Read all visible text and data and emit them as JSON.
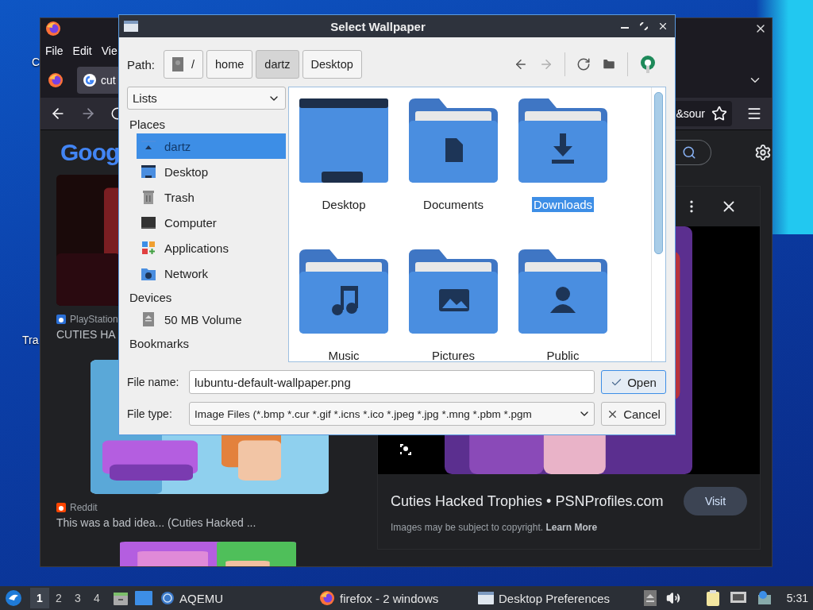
{
  "desktop_labels": [
    "C",
    "Tra"
  ],
  "firefox": {
    "menu": [
      "File",
      "Edit",
      "Vie"
    ],
    "tab": {
      "title": "cut"
    },
    "url_fragment": "&sour",
    "logo_text": "Goog",
    "results": [
      {
        "source": "PlayStation",
        "title": "CUTIES HA",
        "kind": "playstation"
      },
      {
        "source": "Reddit",
        "title": "This was a bad idea... (Cuties Hacked ...",
        "kind": "reddit"
      }
    ],
    "preview": {
      "title": "Cuties Hacked Trophies • PSNProfiles.com",
      "button": "Visit",
      "notice": "Images may be subject to copyright.",
      "link": "Learn More"
    }
  },
  "dialog": {
    "title": "Select Wallpaper",
    "path_label": "Path:",
    "path": [
      {
        "label": "/",
        "kind": "root",
        "selected": false
      },
      {
        "label": "home",
        "kind": "dir",
        "selected": false
      },
      {
        "label": "dartz",
        "kind": "dir",
        "selected": true
      },
      {
        "label": "Desktop",
        "kind": "dir",
        "selected": false
      }
    ],
    "toolbar": [
      {
        "kind": "back",
        "disabled": false
      },
      {
        "kind": "forward",
        "disabled": true
      },
      {
        "kind": "reload",
        "disabled": false
      },
      {
        "kind": "new-folder",
        "disabled": false
      },
      {
        "kind": "app",
        "disabled": false
      }
    ],
    "view_select": "Lists",
    "sidebar": [
      {
        "heading": "Places",
        "items": [
          {
            "label": "dartz",
            "kind": "home",
            "selected": true
          },
          {
            "label": "Desktop",
            "kind": "desktop",
            "selected": false
          },
          {
            "label": "Trash",
            "kind": "trash",
            "selected": false
          },
          {
            "label": "Computer",
            "kind": "computer",
            "selected": false
          },
          {
            "label": "Applications",
            "kind": "applications",
            "selected": false
          },
          {
            "label": "Network",
            "kind": "network",
            "selected": false
          }
        ]
      },
      {
        "heading": "Devices",
        "items": [
          {
            "label": "50 MB Volume",
            "kind": "drive",
            "selected": false
          }
        ]
      },
      {
        "heading": "Bookmarks"
      }
    ],
    "files": [
      {
        "name": "Desktop",
        "kind": "desktop",
        "selected": false
      },
      {
        "name": "Documents",
        "kind": "documents",
        "selected": false
      },
      {
        "name": "Downloads",
        "kind": "downloads",
        "selected": true
      },
      {
        "name": "Music",
        "kind": "music",
        "selected": false
      },
      {
        "name": "Pictures",
        "kind": "pictures",
        "selected": false
      },
      {
        "name": "Public",
        "kind": "public",
        "selected": false
      }
    ],
    "file_name": {
      "label": "File name:",
      "value": "lubuntu-default-wallpaper.png"
    },
    "file_type": {
      "label": "File type:",
      "value": "Image Files (*.bmp *.cur *.gif *.icns *.ico *.jpeg *.jpg *.mng *.pbm *.pgm"
    },
    "buttons": [
      {
        "label": "Open",
        "kind": "open",
        "default": true
      },
      {
        "label": "Cancel",
        "kind": "cancel",
        "default": false
      }
    ]
  },
  "taskbar": {
    "workspaces": [
      {
        "label": "1",
        "selected": true
      },
      {
        "label": "2",
        "selected": false
      },
      {
        "label": "3",
        "selected": false
      },
      {
        "label": "4",
        "selected": false
      }
    ],
    "tasks": [
      {
        "label": "AQEMU",
        "kind": "aqemu"
      },
      {
        "label": "firefox - 2 windows",
        "kind": "firefox"
      },
      {
        "label": "Desktop Preferences",
        "kind": "window"
      }
    ],
    "clock": "5:31"
  }
}
